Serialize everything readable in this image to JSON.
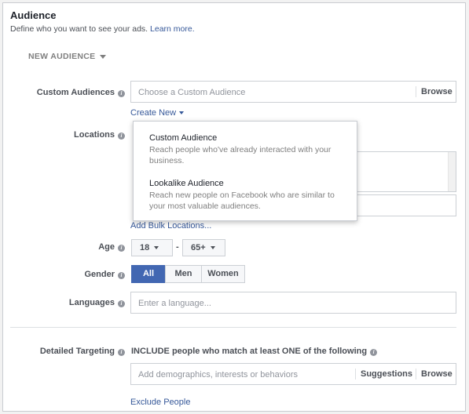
{
  "header": {
    "title": "Audience",
    "subtitle": "Define who you want to see your ads.",
    "learn_more": "Learn more."
  },
  "new_audience": {
    "label": "NEW AUDIENCE"
  },
  "custom_audiences": {
    "label": "Custom Audiences",
    "placeholder": "Choose a Custom Audience",
    "browse": "Browse",
    "create_new": "Create New"
  },
  "dropdown": {
    "items": [
      {
        "title": "Custom Audience",
        "desc_line1": "Reach people who've already interacted with your",
        "desc_line2": "business."
      },
      {
        "title": "Lookalike Audience",
        "desc_line1": "Reach new people on Facebook who are similar to",
        "desc_line2": "your most valuable audiences."
      }
    ]
  },
  "locations": {
    "label": "Locations",
    "add_bulk": "Add Bulk Locations..."
  },
  "age": {
    "label": "Age",
    "min": "18",
    "separator": "-",
    "max": "65+"
  },
  "gender": {
    "label": "Gender",
    "options": [
      "All",
      "Men",
      "Women"
    ],
    "selected": "All"
  },
  "languages": {
    "label": "Languages",
    "placeholder": "Enter a language..."
  },
  "detailed_targeting": {
    "label": "Detailed Targeting",
    "include_text": "INCLUDE people who match at least ONE of the following",
    "placeholder": "Add demographics, interests or behaviors",
    "suggestions": "Suggestions",
    "browse": "Browse",
    "exclude": "Exclude People"
  },
  "colors": {
    "accent": "#4267b2",
    "link": "#365899",
    "border": "#ccd0d5"
  },
  "icons": {
    "info": "info-icon",
    "caret": "chevron-down-icon"
  }
}
